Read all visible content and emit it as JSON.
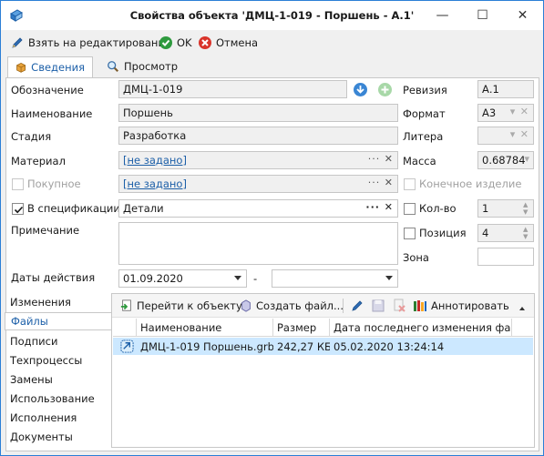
{
  "window": {
    "title": "Свойства объекта 'ДМЦ-1-019 - Поршень - А.1'",
    "min_glyph": "—",
    "max_glyph": "☐",
    "close_glyph": "✕"
  },
  "toolbar": {
    "edit_label": "Взять на редактирование",
    "ok_label": "OK",
    "cancel_label": "Отмена"
  },
  "tabs": [
    {
      "label": "Сведения",
      "active": true
    },
    {
      "label": "Просмотр",
      "active": false
    }
  ],
  "form": {
    "designation": {
      "label": "Обозначение",
      "value": "ДМЦ-1-019"
    },
    "name": {
      "label": "Наименование",
      "value": "Поршень"
    },
    "stage": {
      "label": "Стадия",
      "value": "Разработка"
    },
    "material": {
      "label": "Материал",
      "value": "[не задано]"
    },
    "purchased": {
      "label": "Покупное",
      "value": "[не задано]",
      "checked": false
    },
    "revision": {
      "label": "Ревизия",
      "value": "А.1"
    },
    "format": {
      "label": "Формат",
      "value": "А3"
    },
    "litera": {
      "label": "Литера",
      "value": ""
    },
    "mass": {
      "label": "Масса",
      "value": "0.68784"
    },
    "final_product": {
      "label": "Конечное изделие",
      "checked": false
    },
    "in_spec": {
      "label": "В спецификации",
      "value": "Детали",
      "checked": true
    },
    "qty": {
      "label": "Кол-во",
      "value": "1",
      "checked": false
    },
    "position": {
      "label": "Позиция",
      "value": "4",
      "checked": false
    },
    "note": {
      "label": "Примечание",
      "value": ""
    },
    "zone": {
      "label": "Зона",
      "value": ""
    },
    "dates": {
      "label": "Даты действия",
      "from": "01.09.2020",
      "separator": "-",
      "to": ""
    }
  },
  "side_nav": [
    {
      "label": "Изменения",
      "selected": false
    },
    {
      "label": "Файлы",
      "selected": true
    },
    {
      "label": "Подписи",
      "selected": false
    },
    {
      "label": "Техпроцессы",
      "selected": false
    },
    {
      "label": "Замены",
      "selected": false
    },
    {
      "label": "Использование",
      "selected": false
    },
    {
      "label": "Исполнения",
      "selected": false
    },
    {
      "label": "Документы",
      "selected": false
    }
  ],
  "files": {
    "toolbar": {
      "goto_label": "Перейти к объекту",
      "create_label": "Создать файл...",
      "annotate_label": "Аннотировать"
    },
    "columns": [
      "Наименование",
      "Размер",
      "Дата последнего изменения файла"
    ],
    "rows": [
      {
        "name": "ДМЦ-1-019 Поршень.grb",
        "size": "242,27 КБ",
        "modified": "05.02.2020 13:24:14"
      }
    ]
  },
  "colors": {
    "accent": "#1c5fa8",
    "selection": "#cce8ff",
    "ok_green": "#2e9a3e",
    "cancel_red": "#d9342b"
  }
}
